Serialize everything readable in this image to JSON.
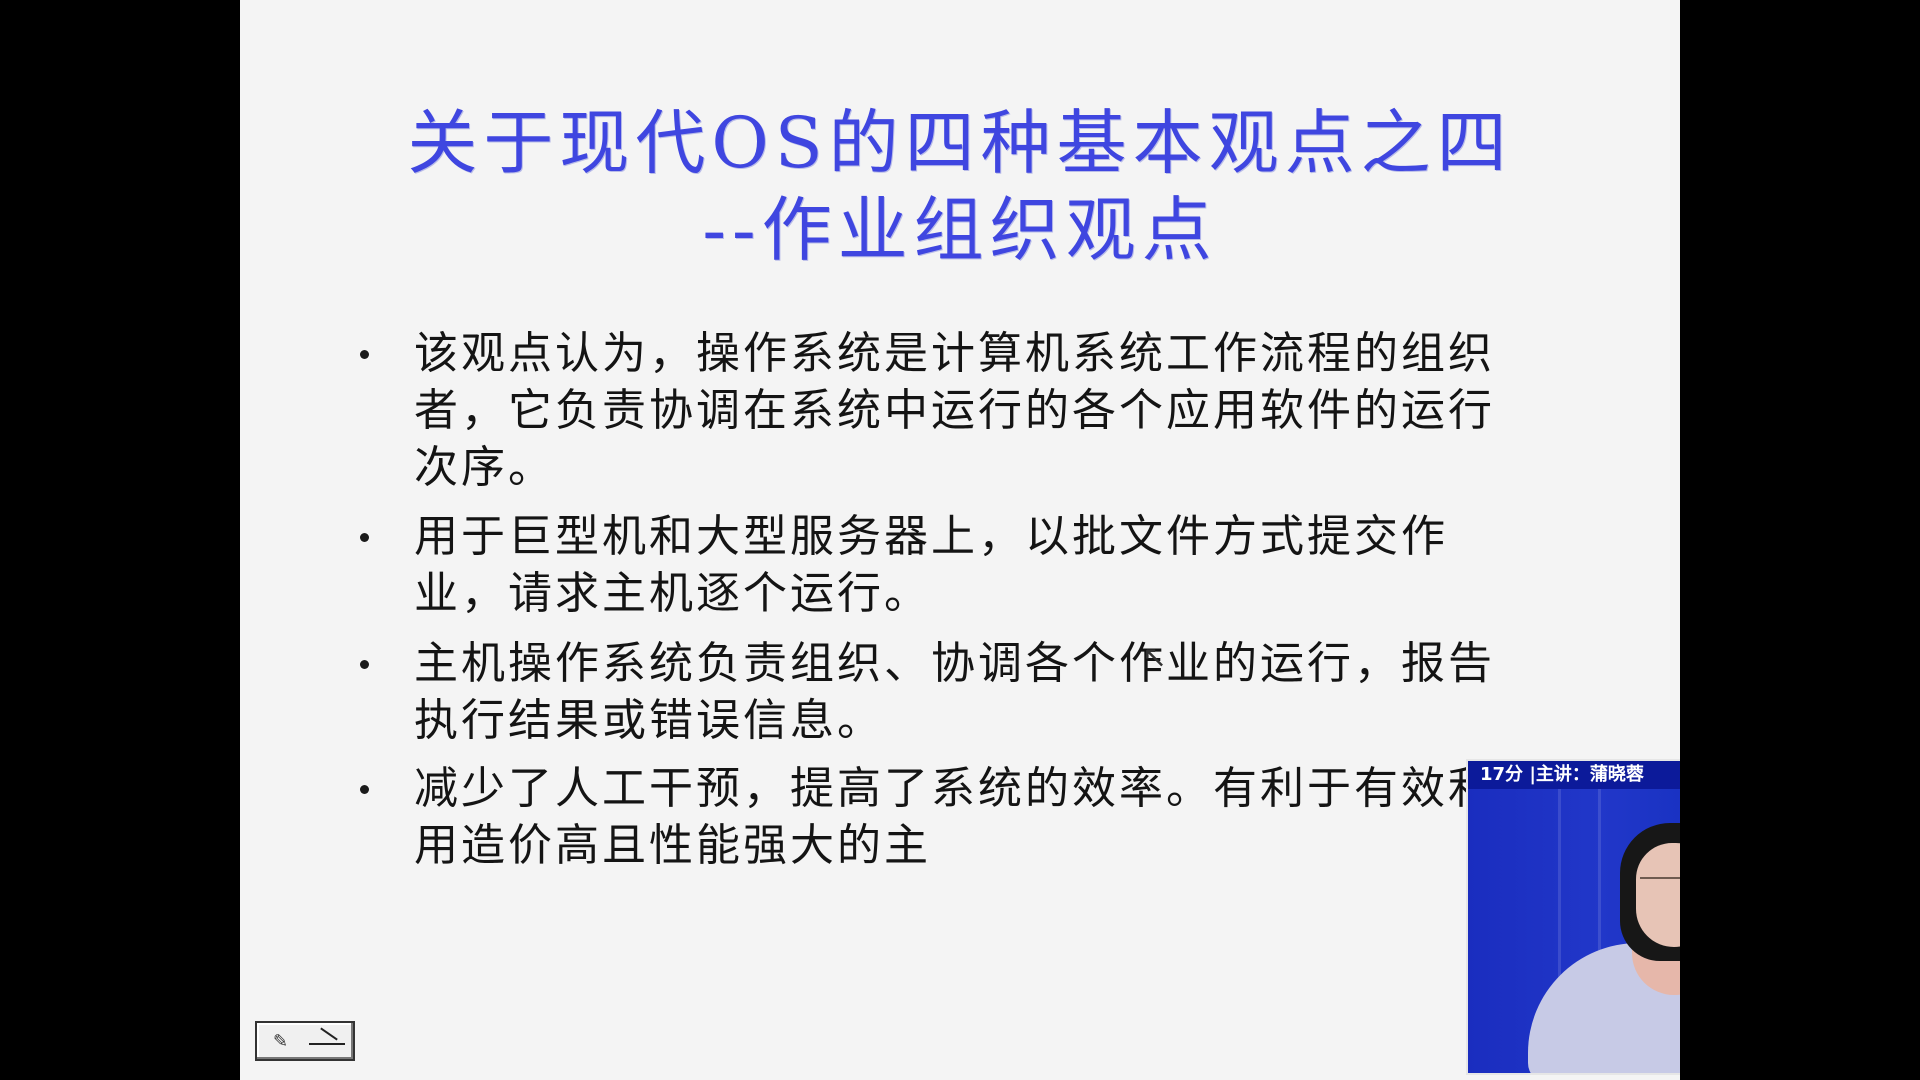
{
  "slide": {
    "title_line1": "关于现代OS的四种基本观点之四",
    "title_line2": "--作业组织观点",
    "bullets": [
      "该观点认为，操作系统是计算机系统工作流程的组织者，它负责协调在系统中运行的各个应用软件的运行次序。",
      "用于巨型机和大型服务器上，以批文件方式提交作业，请求主机逐个运行。",
      "主机操作系统负责组织、协调各个作业的运行，报告执行结果或错误信息。",
      "减少了人工干预，提高了系统的效率。有利于有效利用造价高且性能强大的主"
    ]
  },
  "video": {
    "caption": "17分 |主讲：蒲晓蓉"
  },
  "controls": {
    "icon": "slide-control-icon"
  },
  "colors": {
    "title": "#3f46e0",
    "slide_bg": "#f4f4f4",
    "video_bar": "#0c1a9a",
    "video_bg": "#1a2dbf"
  }
}
